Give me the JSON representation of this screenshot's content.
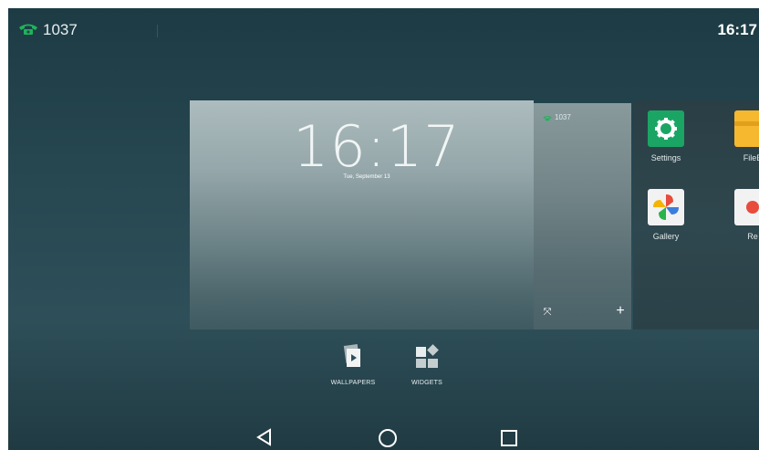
{
  "status_bar": {
    "extension": "1037",
    "time": "16:17"
  },
  "home_preview": {
    "clock": "16:17",
    "date": "Tue, September 13"
  },
  "mini_page": {
    "extension": "1037"
  },
  "apps": [
    {
      "label": "Settings",
      "icon": "settings-icon"
    },
    {
      "label": "FileB",
      "icon": "file-browser-icon"
    },
    {
      "label": "Gallery",
      "icon": "gallery-icon"
    },
    {
      "label": "Re",
      "icon": "recorder-icon"
    }
  ],
  "edit_options": [
    {
      "label": "WALLPAPERS",
      "icon": "wallpapers-icon"
    },
    {
      "label": "WIDGETS",
      "icon": "widgets-icon"
    }
  ],
  "nav": {
    "back": "back-icon",
    "home": "home-icon",
    "recents": "recents-icon"
  },
  "colors": {
    "call_green": "#1fb35a",
    "settings_green": "#1aa565",
    "file_yellow": "#f5b82e"
  }
}
